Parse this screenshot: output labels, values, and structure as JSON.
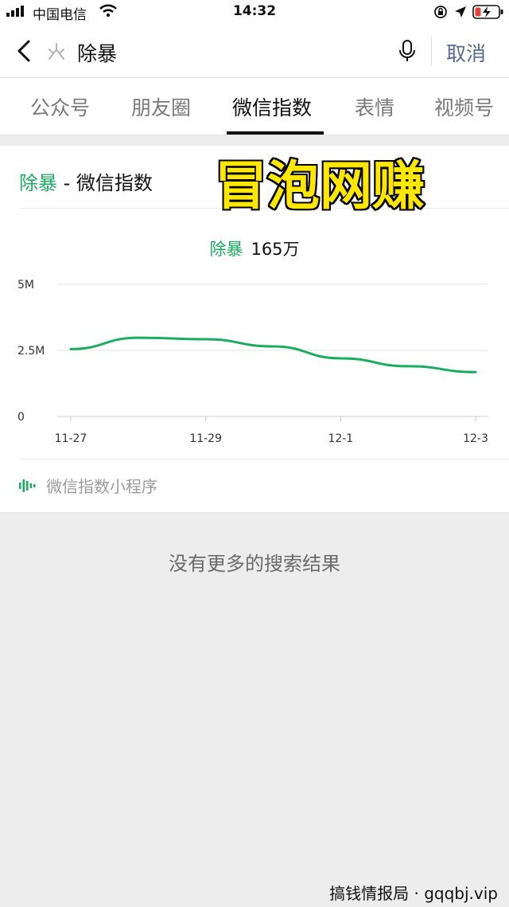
{
  "status_bar": {
    "carrier": "中国电信",
    "time": "14:32"
  },
  "search": {
    "query": "除暴",
    "cancel_label": "取消"
  },
  "tabs": [
    {
      "label": "公众号",
      "active": false
    },
    {
      "label": "朋友圈",
      "active": false
    },
    {
      "label": "微信指数",
      "active": true
    },
    {
      "label": "表情",
      "active": false
    },
    {
      "label": "视频号",
      "active": false
    }
  ],
  "index_card": {
    "keyword": "除暴",
    "title_suffix": " - 微信指数",
    "legend_keyword": "除暴",
    "legend_value": "165万",
    "mini_program_label": "微信指数小程序"
  },
  "chart_data": {
    "type": "line",
    "x": [
      "11-27",
      "11-28",
      "11-29",
      "11-30",
      "12-1",
      "12-2",
      "12-3"
    ],
    "x_tick_labels": [
      "11-27",
      "11-29",
      "12-1",
      "12-3"
    ],
    "series": [
      {
        "values": [
          2.55,
          2.98,
          2.92,
          2.65,
          2.2,
          1.9,
          1.68
        ]
      }
    ],
    "y_tick_labels": [
      "5M",
      "2.5M",
      "0"
    ],
    "ylim": [
      0,
      5
    ],
    "grid": true,
    "line_color": "#1aad5f"
  },
  "no_more_results": "没有更多的搜索结果",
  "overlay_caption": "冒泡网赚",
  "watermark": "搞钱情报局 · gqqbj.vip",
  "colors": {
    "accent_green": "#1aad5f",
    "link_blue": "#576b95",
    "background": "#ededed"
  },
  "icons": {
    "back": "chevron-left-icon",
    "search_logo": "wechat-search-icon",
    "mic": "microphone-icon",
    "mini_program": "sound-wave-icon"
  }
}
